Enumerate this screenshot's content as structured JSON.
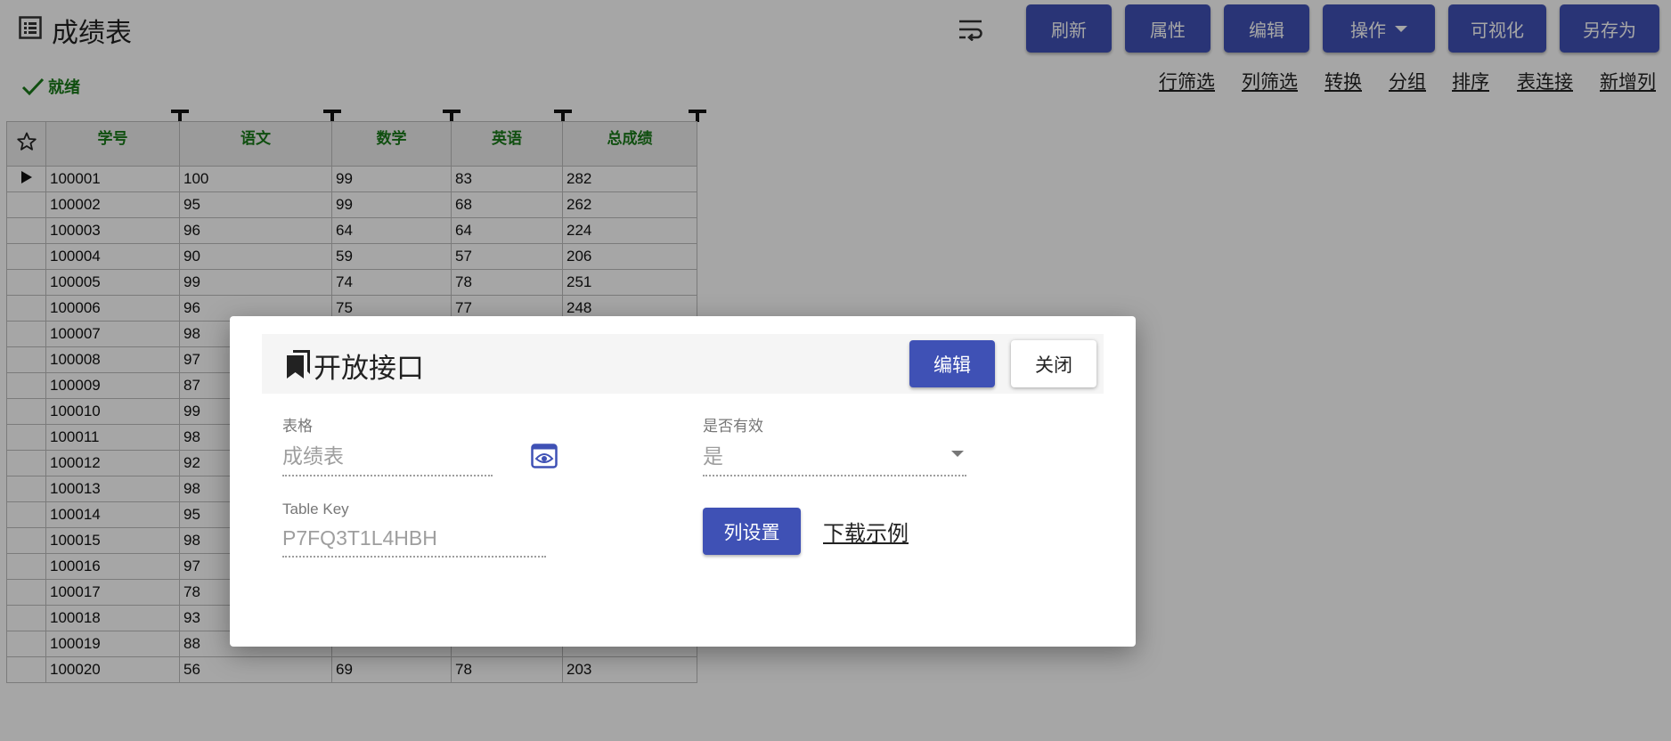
{
  "app": {
    "title": "成绩表",
    "status": "就绪"
  },
  "toolbar": {
    "buttons": [
      "刷新",
      "属性",
      "编辑",
      "操作",
      "可视化",
      "另存为"
    ]
  },
  "table_links": [
    "行筛选",
    "列筛选",
    "转换",
    "分组",
    "排序",
    "表连接",
    "新增列"
  ],
  "table": {
    "headers": [
      "学号",
      "语文",
      "数学",
      "英语",
      "总成绩"
    ],
    "rows": [
      [
        "100001",
        "100",
        "99",
        "83",
        "282"
      ],
      [
        "100002",
        "95",
        "99",
        "68",
        "262"
      ],
      [
        "100003",
        "96",
        "64",
        "64",
        "224"
      ],
      [
        "100004",
        "90",
        "59",
        "57",
        "206"
      ],
      [
        "100005",
        "99",
        "74",
        "78",
        "251"
      ],
      [
        "100006",
        "96",
        "75",
        "77",
        "248"
      ],
      [
        "100007",
        "98",
        "",
        "",
        ""
      ],
      [
        "100008",
        "97",
        "",
        "",
        ""
      ],
      [
        "100009",
        "87",
        "",
        "",
        ""
      ],
      [
        "100010",
        "99",
        "",
        "",
        ""
      ],
      [
        "100011",
        "98",
        "",
        "",
        ""
      ],
      [
        "100012",
        "92",
        "",
        "",
        ""
      ],
      [
        "100013",
        "98",
        "",
        "",
        ""
      ],
      [
        "100014",
        "95",
        "",
        "",
        ""
      ],
      [
        "100015",
        "98",
        "",
        "",
        ""
      ],
      [
        "100016",
        "97",
        "",
        "",
        ""
      ],
      [
        "100017",
        "78",
        "",
        "",
        ""
      ],
      [
        "100018",
        "93",
        "",
        "",
        ""
      ],
      [
        "100019",
        "88",
        "",
        "",
        ""
      ],
      [
        "100020",
        "56",
        "69",
        "78",
        "203"
      ]
    ]
  },
  "dialog": {
    "title": "开放接口",
    "edit_label": "编辑",
    "close_label": "关闭",
    "table_label": "表格",
    "table_value": "成绩表",
    "valid_label": "是否有效",
    "valid_value": "是",
    "key_label": "Table Key",
    "key_value": "P7FQ3T1L4HBH",
    "column_setting_label": "列设置",
    "download_example_label": "下载示例"
  },
  "colors": {
    "primary": "#3f51b5",
    "status_green": "#1a7a1a",
    "overlay": "rgba(0,0,0,0.35)"
  },
  "icons": {
    "title": "table-list-icon",
    "wrap": "text-wrap-icon",
    "status": "check-icon",
    "star": "star-outline-icon",
    "row_marker": "play-arrow-icon",
    "dialog": "bookmarks-icon",
    "view": "eye-icon",
    "dropdown": "chevron-down-icon"
  }
}
